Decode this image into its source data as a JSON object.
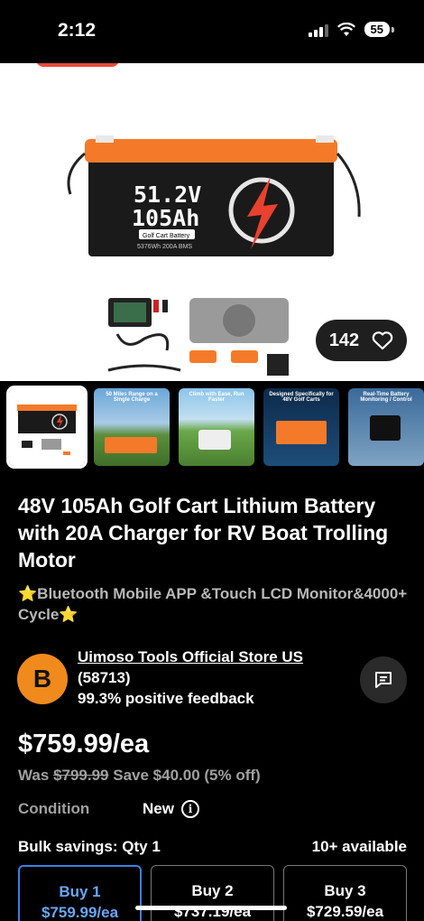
{
  "status": {
    "time": "2:12",
    "battery": "55"
  },
  "hero": {
    "like_count": "142"
  },
  "battery_label": {
    "voltage": "51.2V",
    "capacity": "105Ah",
    "tag": "Golf Cart Battery",
    "spec": "5376Wh  200A BMS"
  },
  "thumbnails": [
    {
      "caption": ""
    },
    {
      "caption": "50 Miles Range on a Single Charge"
    },
    {
      "caption": "Climb with Ease, Run Faster"
    },
    {
      "caption": "Designed Specifically for 48V Golf Carts"
    },
    {
      "caption": "Real-Time Battery Monitoring / Control"
    }
  ],
  "listing": {
    "title": "48V 105Ah Golf Cart Lithium Battery with 20A Charger for RV Boat Trolling Motor",
    "subtitle": "⭐Bluetooth Mobile APP &Touch LCD Monitor&4000+ Cycle⭐"
  },
  "seller": {
    "initial": "B",
    "name": "Uimoso Tools Official Store US",
    "count": "(58713)",
    "feedback": "99.3% positive feedback"
  },
  "price": {
    "current": "$759.99/ea",
    "was_label": "Was",
    "was_price": "$799.99",
    "savings": "Save $40.00 (5% off)"
  },
  "condition": {
    "label": "Condition",
    "value": "New"
  },
  "bulk": {
    "label": "Bulk savings: Qty 1",
    "available": "10+ available",
    "options": [
      {
        "qty": "Buy 1",
        "price": "$759.99/ea"
      },
      {
        "qty": "Buy 2",
        "price": "$737.19/ea"
      },
      {
        "qty": "Buy 3",
        "price": "$729.59/ea"
      }
    ]
  },
  "colors": {
    "accent": "#f08a1c",
    "link_blue": "#3a7fe0",
    "battery_orange": "#f47a2a"
  }
}
